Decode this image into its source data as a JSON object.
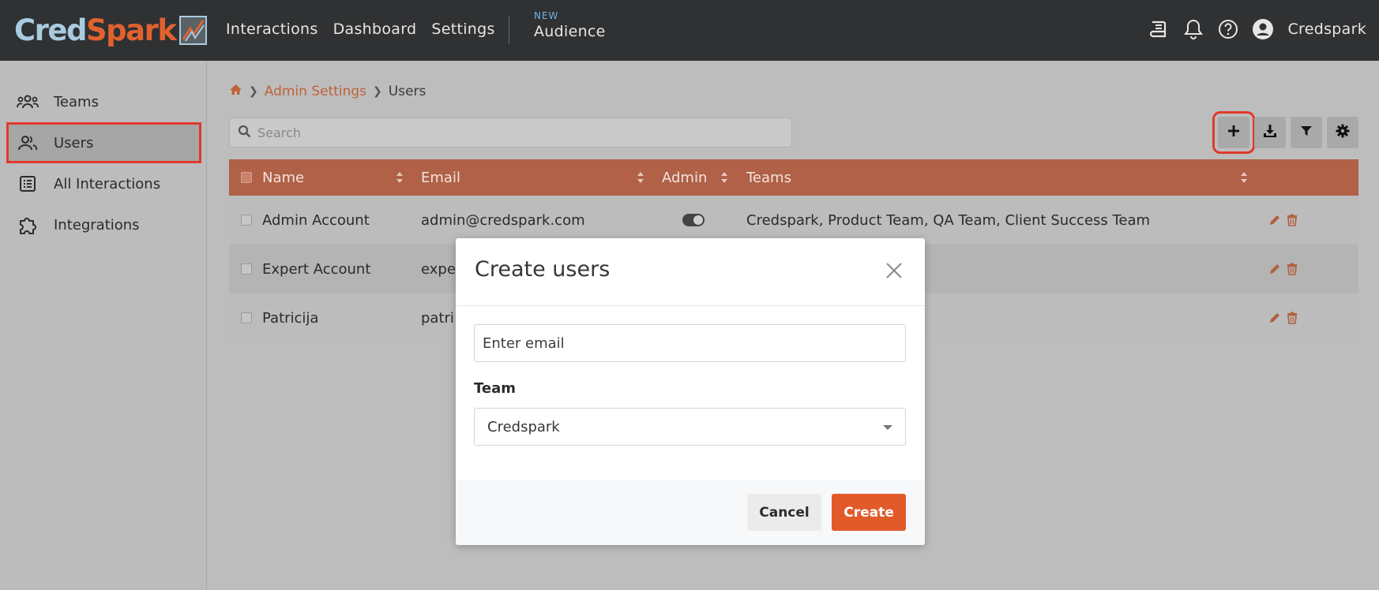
{
  "brand": {
    "part1": "Cred",
    "part2": "Spark",
    "accent": "#e0622e",
    "secondary": "#a9cbe0"
  },
  "nav": {
    "items": [
      "Interactions",
      "Dashboard",
      "Settings"
    ],
    "audience_badge": "NEW",
    "audience_label": "Audience"
  },
  "header": {
    "user_name": "Credspark",
    "icons": [
      "book-icon",
      "bell-icon",
      "help-icon",
      "user-circle-icon"
    ]
  },
  "sidebar": {
    "items": [
      {
        "label": "Teams",
        "icon": "teams-icon"
      },
      {
        "label": "Users",
        "icon": "users-icon",
        "active": true
      },
      {
        "label": "All Interactions",
        "icon": "list-icon"
      },
      {
        "label": "Integrations",
        "icon": "puzzle-icon"
      }
    ]
  },
  "breadcrumb": {
    "parent": "Admin Settings",
    "current": "Users"
  },
  "search": {
    "placeholder": "Search",
    "value": ""
  },
  "toolbar": {
    "buttons": [
      "plus-icon",
      "download-icon",
      "filter-icon",
      "gear-icon"
    ]
  },
  "table": {
    "header_color": "#b06148",
    "columns": [
      "Name",
      "Email",
      "Admin",
      "Teams"
    ],
    "rows": [
      {
        "name": "Admin Account",
        "email": "admin@credspark.com",
        "admin": true,
        "teams": "Credspark, Product Team, QA Team, Client Success Team"
      },
      {
        "name": "Expert Account",
        "email": "expe",
        "admin": false,
        "teams": ""
      },
      {
        "name": "Patricija",
        "email": "patri",
        "admin": false,
        "teams": ""
      }
    ]
  },
  "modal": {
    "title": "Create users",
    "email_placeholder": "Enter email",
    "team_label": "Team",
    "team_selected": "Credspark",
    "cancel_label": "Cancel",
    "create_label": "Create",
    "create_color": "#e25a2a"
  }
}
